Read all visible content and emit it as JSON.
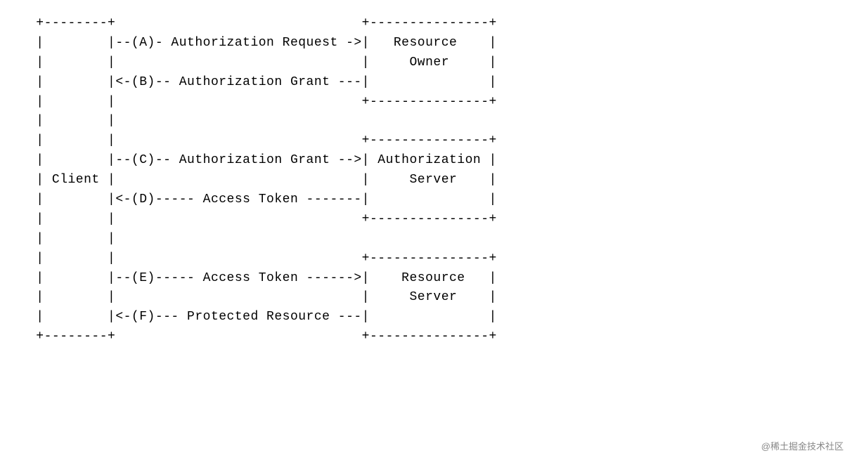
{
  "diagram": {
    "left_entity": "Client",
    "right_entities": [
      {
        "line1": "Resource",
        "line2": "Owner"
      },
      {
        "line1": "Authorization",
        "line2": "Server"
      },
      {
        "line1": "Resource",
        "line2": "Server"
      }
    ],
    "flows": [
      {
        "label": "A",
        "text": "Authorization Request",
        "direction": "right"
      },
      {
        "label": "B",
        "text": "Authorization Grant",
        "direction": "left"
      },
      {
        "label": "C",
        "text": "Authorization Grant",
        "direction": "right"
      },
      {
        "label": "D",
        "text": "Access Token",
        "direction": "left"
      },
      {
        "label": "E",
        "text": "Access Token",
        "direction": "right"
      },
      {
        "label": "F",
        "text": "Protected Resource",
        "direction": "left"
      }
    ],
    "lines": {
      "l00": " +--------+                               +---------------+",
      "l01": " |        |--(A)- Authorization Request ->|   Resource    |",
      "l02": " |        |                               |     Owner     |",
      "l03": " |        |<-(B)-- Authorization Grant ---|               |",
      "l04": " |        |                               +---------------+",
      "l05": " |        |",
      "l06": " |        |                               +---------------+",
      "l07": " |        |--(C)-- Authorization Grant -->| Authorization |",
      "l08": " | Client |                               |     Server    |",
      "l09": " |        |<-(D)----- Access Token -------|               |",
      "l10": " |        |                               +---------------+",
      "l11": " |        |",
      "l12": " |        |                               +---------------+",
      "l13": " |        |--(E)----- Access Token ------>|    Resource   |",
      "l14": " |        |                               |     Server    |",
      "l15": " |        |<-(F)--- Protected Resource ---|               |",
      "l16": " +--------+                               +---------------+"
    }
  },
  "watermark": "@稀土掘金技术社区"
}
